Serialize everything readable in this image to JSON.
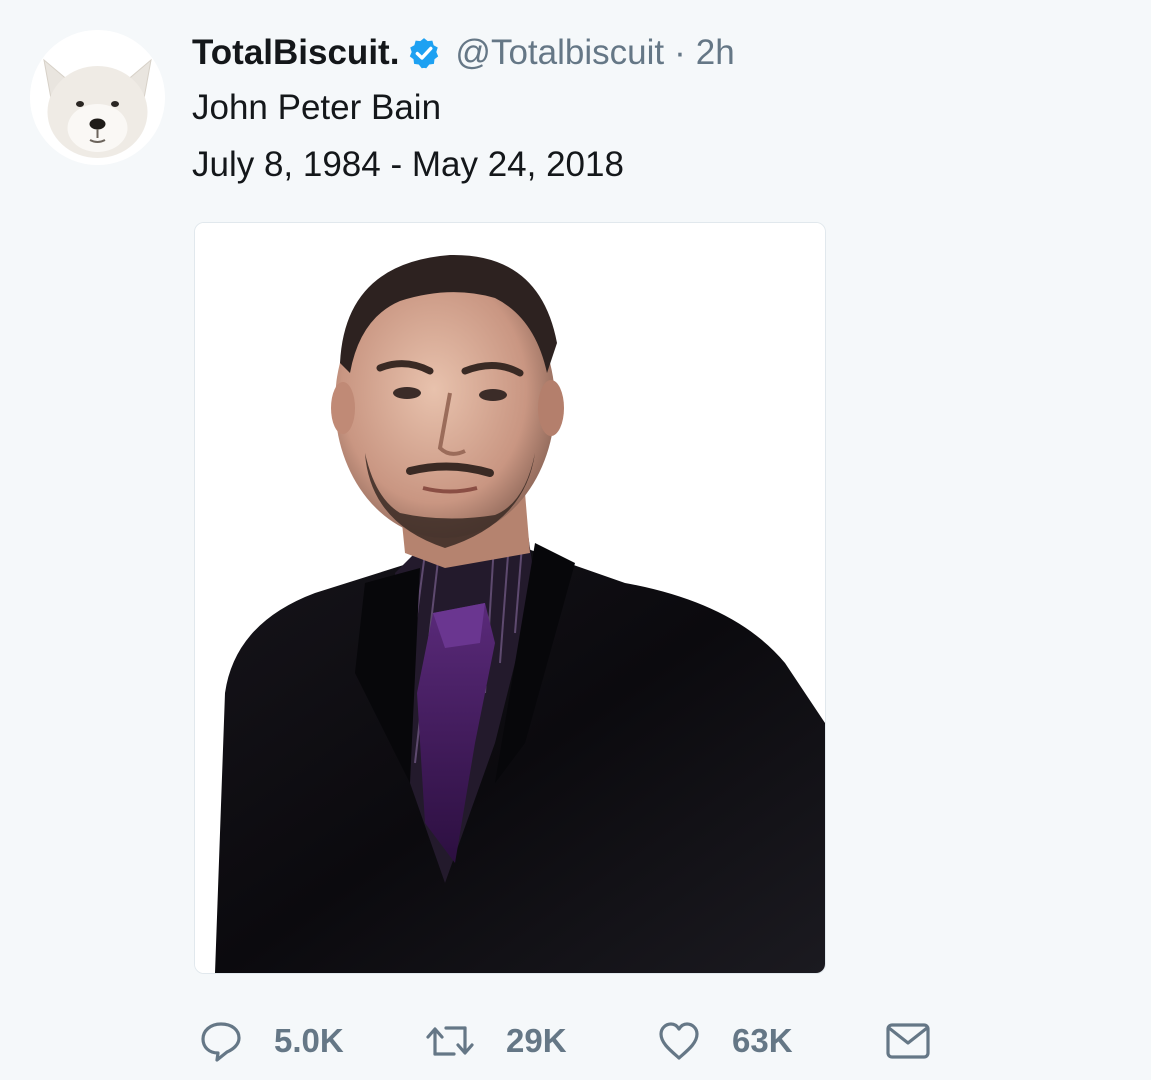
{
  "tweet": {
    "author": {
      "display_name": "TotalBiscuit.",
      "handle": "@Totalbiscuit",
      "verified": true,
      "avatar_icon": "dog-avatar-icon"
    },
    "separator": "·",
    "time": "2h",
    "text_lines": [
      "John Peter Bain",
      "July 8, 1984 - May 24, 2018"
    ],
    "media": {
      "type": "photo"
    },
    "actions": {
      "reply": {
        "icon": "reply-icon",
        "count": "5.0K"
      },
      "retweet": {
        "icon": "retweet-icon",
        "count": "29K"
      },
      "like": {
        "icon": "heart-icon",
        "count": "63K"
      },
      "direct_message": {
        "icon": "envelope-icon"
      }
    }
  },
  "colors": {
    "background": "#f5f8fa",
    "text": "#14171a",
    "secondary_text": "#657786",
    "verified_blue": "#1da1f2"
  }
}
